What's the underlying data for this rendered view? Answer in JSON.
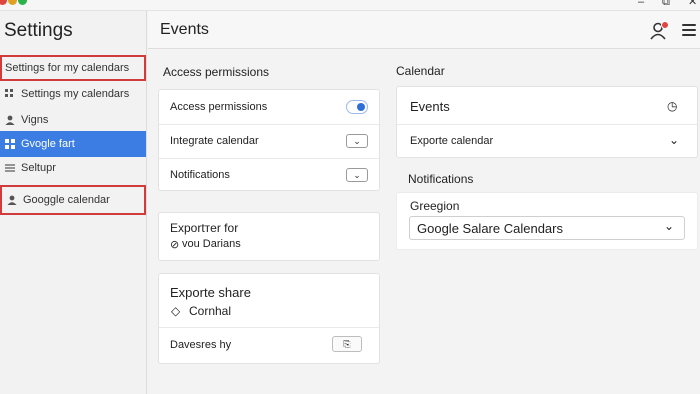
{
  "window": {
    "minimize": "‒",
    "restore": "⧉",
    "close": "✕"
  },
  "sidebar": {
    "title": "Settings",
    "items": [
      {
        "label": "Settings for my calendars"
      },
      {
        "label": "Settings my calendars"
      },
      {
        "label": "Vigns"
      },
      {
        "label": "Gvogle fart"
      },
      {
        "label": "Seltupr"
      },
      {
        "label": "Googgle calendar"
      }
    ]
  },
  "header": {
    "title": "Events"
  },
  "left_col": {
    "section_label": "Access permissions",
    "permissions_card": {
      "rows": [
        {
          "label": "Access permissions"
        },
        {
          "label": "Integrate calendar",
          "control": "⌄"
        },
        {
          "label": "Notifications",
          "control": "⌄"
        }
      ]
    },
    "export_card": {
      "line1": "Exportтer for",
      "line2": "vou Darians",
      "line2_icon": "⊘"
    },
    "share_card": {
      "title": "Exporte share",
      "subtitle": "Cornhal",
      "subtitle_icon": "◇",
      "row_label": "Davesres hy",
      "button_icon": "⎘"
    }
  },
  "right_col": {
    "section_label": "Calendar",
    "calendar_card": {
      "title": "Events",
      "title_icon": "◷",
      "row_label": "Exporte calendar",
      "row_icon": "⌄"
    },
    "notifications_label": "Notifications",
    "notifications_card": {
      "field_label": "Greegion",
      "select_value": "Google Salare Calendars",
      "select_icon": "⌄"
    }
  },
  "colors": {
    "accent": "#3b7de3",
    "highlight_outline": "#d23b3b",
    "toggle_on": "#2d6fd8"
  }
}
